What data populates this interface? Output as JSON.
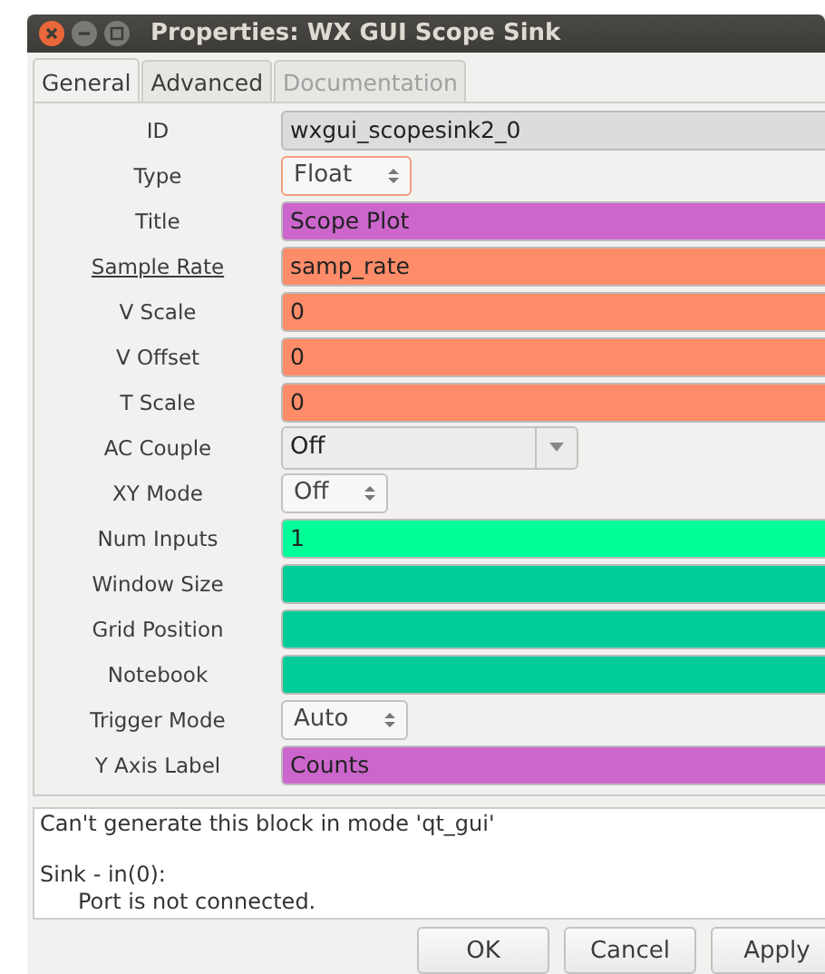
{
  "window": {
    "title": "Properties: WX GUI Scope Sink"
  },
  "tabs": [
    {
      "label": "General",
      "selected": true,
      "disabled": false
    },
    {
      "label": "Advanced",
      "selected": false,
      "disabled": false
    },
    {
      "label": "Documentation",
      "selected": false,
      "disabled": true
    }
  ],
  "params": [
    {
      "label": "ID",
      "underlined": false,
      "kind": "entry",
      "value": "wxgui_scopesink2_0",
      "color": "#dcdcdc"
    },
    {
      "label": "Type",
      "underlined": false,
      "kind": "spin",
      "value": "Float",
      "focused": true
    },
    {
      "label": "Title",
      "underlined": false,
      "kind": "entry",
      "value": "Scope Plot",
      "color": "#cc66cc"
    },
    {
      "label": "Sample Rate",
      "underlined": true,
      "kind": "entry",
      "value": "samp_rate",
      "color": "#ff8c69"
    },
    {
      "label": "V Scale",
      "underlined": false,
      "kind": "entry",
      "value": "0",
      "color": "#ff8c69"
    },
    {
      "label": "V Offset",
      "underlined": false,
      "kind": "entry",
      "value": "0",
      "color": "#ff8c69"
    },
    {
      "label": "T Scale",
      "underlined": false,
      "kind": "entry",
      "value": "0",
      "color": "#ff8c69"
    },
    {
      "label": "AC Couple",
      "underlined": false,
      "kind": "dropdown",
      "value": "Off"
    },
    {
      "label": "XY Mode",
      "underlined": false,
      "kind": "spin",
      "value": "Off",
      "focused": false
    },
    {
      "label": "Num Inputs",
      "underlined": false,
      "kind": "entry",
      "value": "1",
      "color": "#00ff99"
    },
    {
      "label": "Window Size",
      "underlined": false,
      "kind": "entry",
      "color": "#00cc99"
    },
    {
      "label": "Grid Position",
      "underlined": false,
      "kind": "entry",
      "color": "#00cc99"
    },
    {
      "label": "Notebook",
      "underlined": false,
      "kind": "entry",
      "color": "#00cc99"
    },
    {
      "label": "Trigger Mode",
      "underlined": false,
      "kind": "spin",
      "value": "Auto",
      "focused": false
    },
    {
      "label": "Y Axis Label",
      "underlined": false,
      "kind": "entry",
      "value": "Counts",
      "color": "#cc66cc"
    }
  ],
  "messages": [
    {
      "text": "Can't generate this block in mode 'qt_gui'"
    },
    {
      "text": "Sink - in(0):",
      "children": [
        {
          "text": "Port is not connected."
        }
      ]
    }
  ],
  "buttons": [
    "OK",
    "Cancel",
    "Apply"
  ]
}
